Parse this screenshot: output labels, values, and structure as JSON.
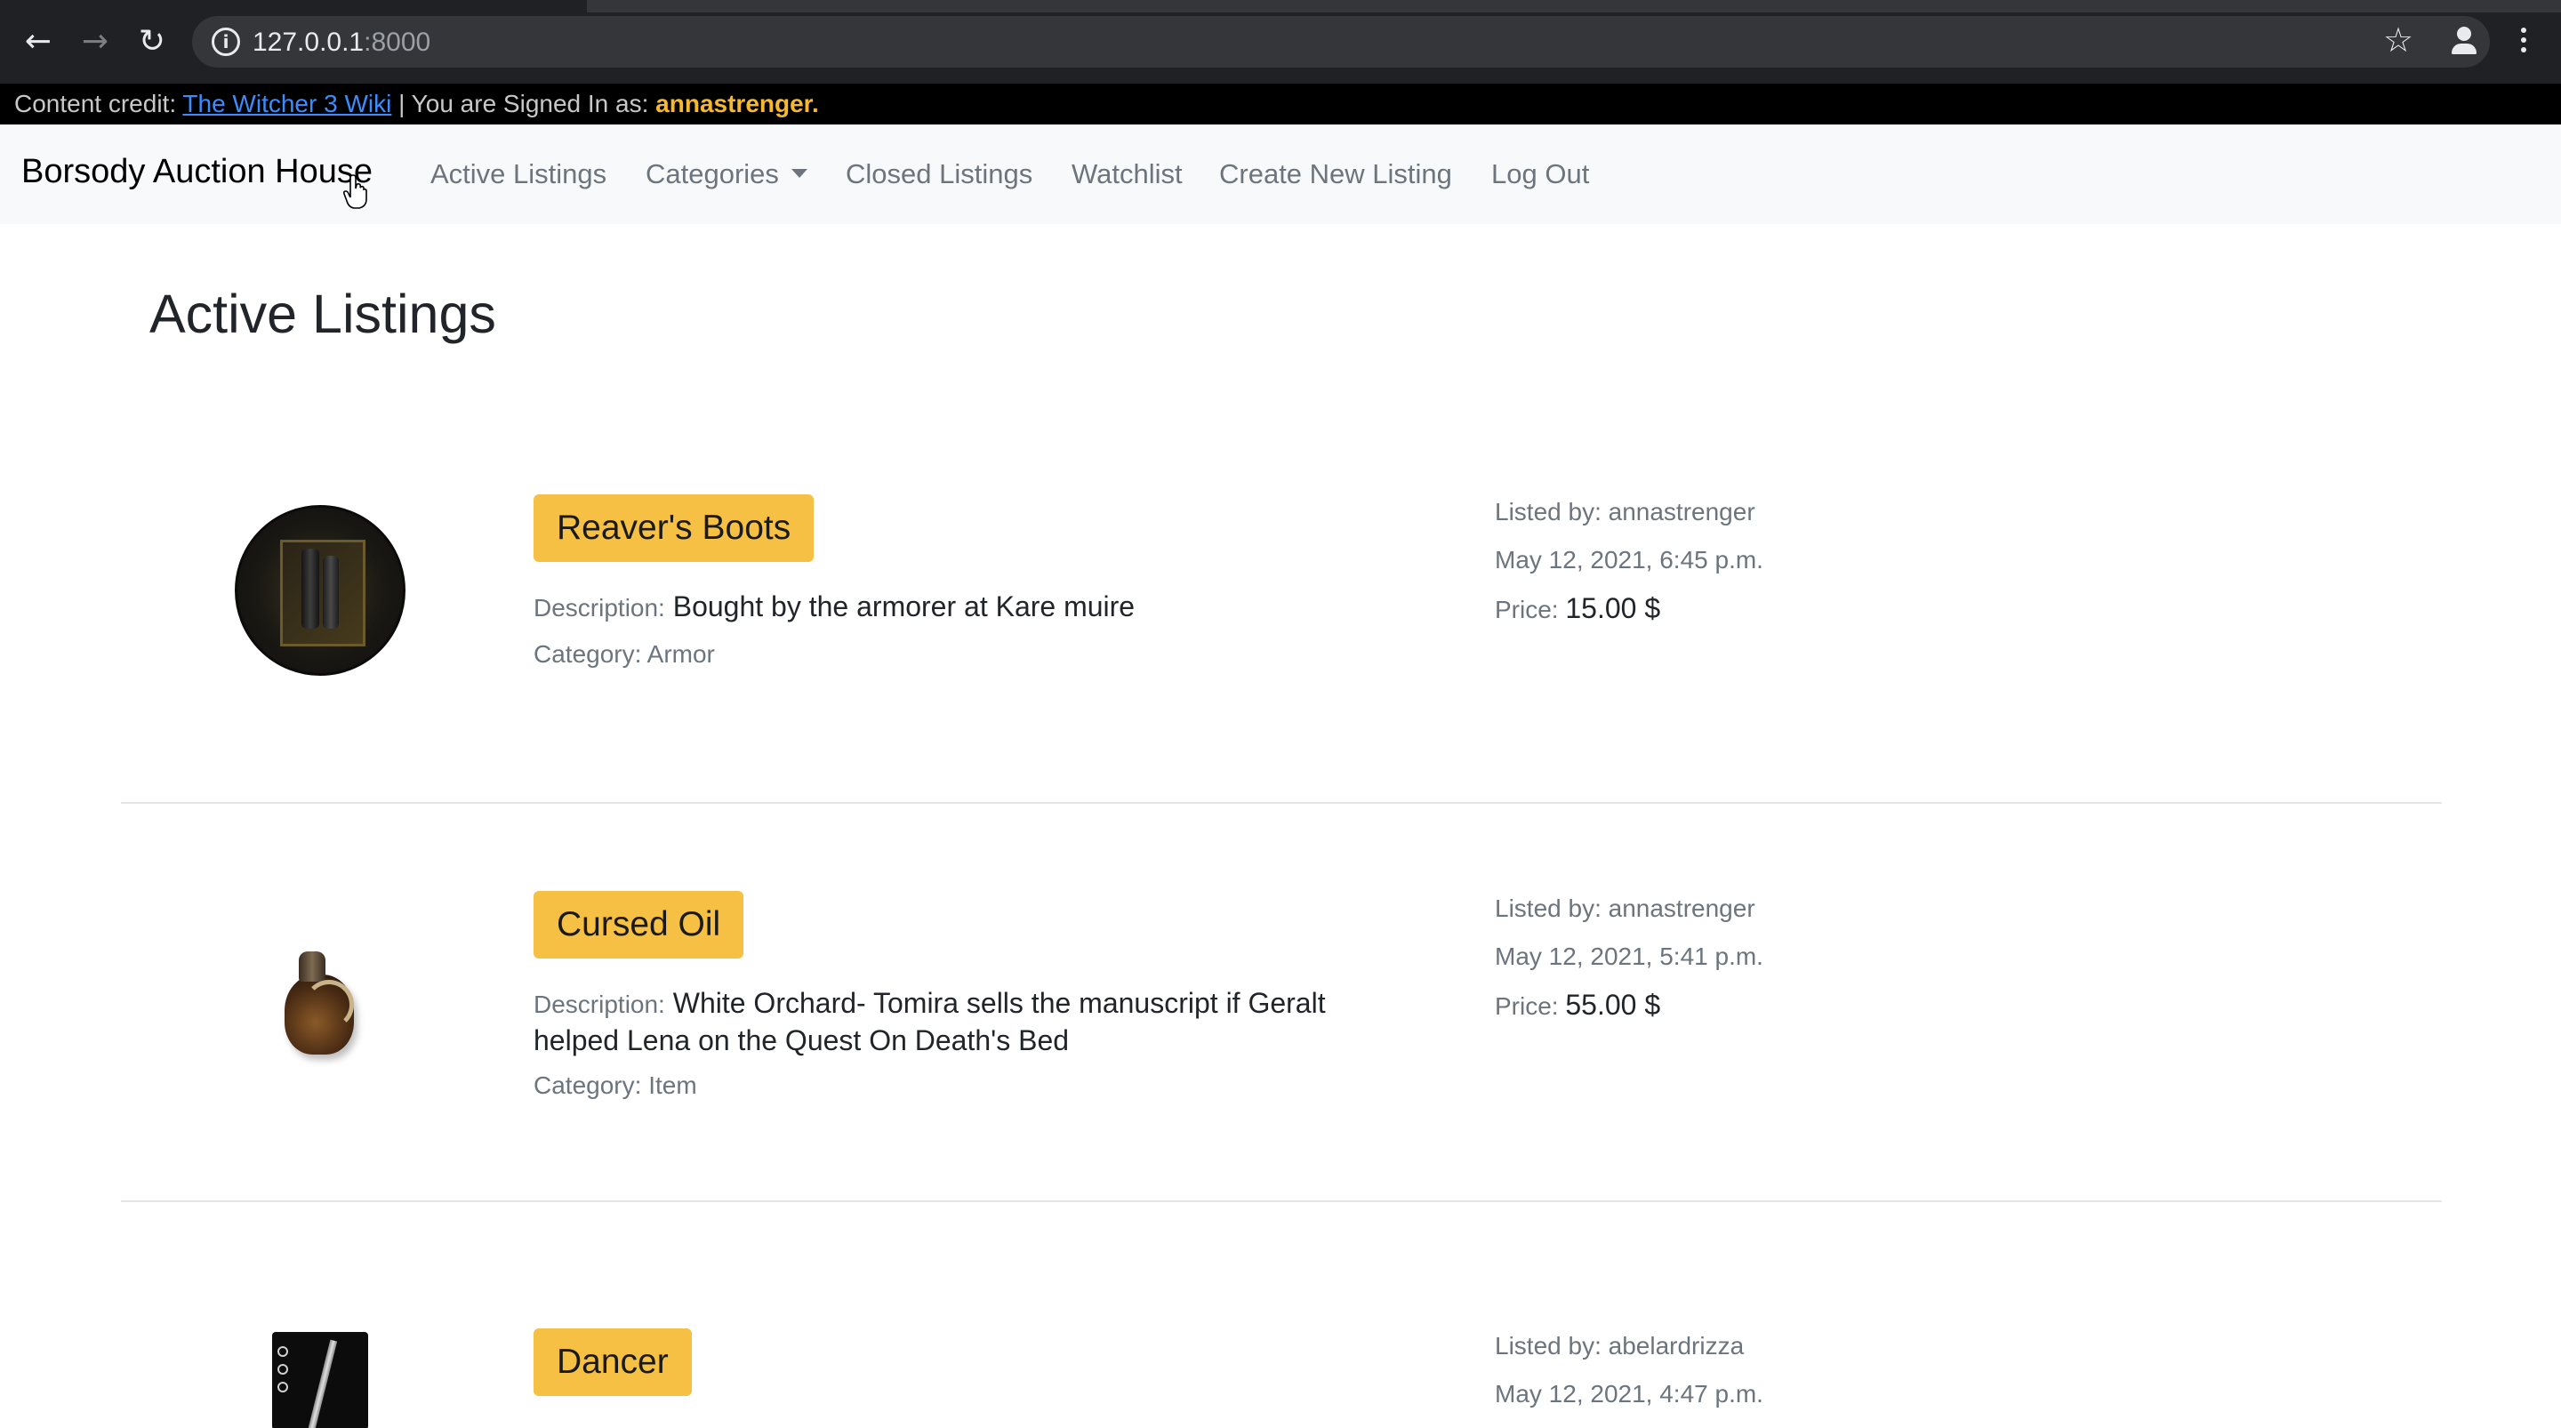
{
  "browser": {
    "url_host": "127.0.0.1",
    "url_port": ":8000"
  },
  "credit_bar": {
    "prefix": "Content credit:",
    "link": "The Witcher 3 Wiki",
    "separator": "| You are Signed In as:",
    "username": "annastrenger."
  },
  "navbar": {
    "brand": "Borsody Auction House",
    "links": [
      "Active Listings",
      "Categories",
      "Closed Listings",
      "Watchlist",
      "Create New Listing",
      "Log Out"
    ]
  },
  "page": {
    "title": "Active Listings"
  },
  "labels": {
    "description": "Description:",
    "category": "Category:",
    "listed_by": "Listed by:",
    "price": "Price:"
  },
  "listings": [
    {
      "title": "Reaver's Boots",
      "description": "Bought by the armorer at Kare muire",
      "category": "Armor",
      "listed_by": "annastrenger",
      "date": "May 12, 2021, 6:45 p.m.",
      "price": "15.00 $",
      "image_icon": "boots-icon"
    },
    {
      "title": "Cursed Oil",
      "description": "White Orchard- Tomira sells the manuscript if Geralt helped Lena on the Quest On Death's Bed",
      "category": "Item",
      "listed_by": "annastrenger",
      "date": "May 12, 2021, 5:41 p.m.",
      "price": "55.00 $",
      "image_icon": "oil-bottle-icon"
    },
    {
      "title": "Dancer",
      "listed_by": "abelardrizza",
      "date": "May 12, 2021, 4:47 p.m.",
      "image_icon": "sword-icon"
    }
  ],
  "colors": {
    "badge": "#f5c044",
    "credit_link": "#3a8cff",
    "username": "#f5b82e"
  }
}
